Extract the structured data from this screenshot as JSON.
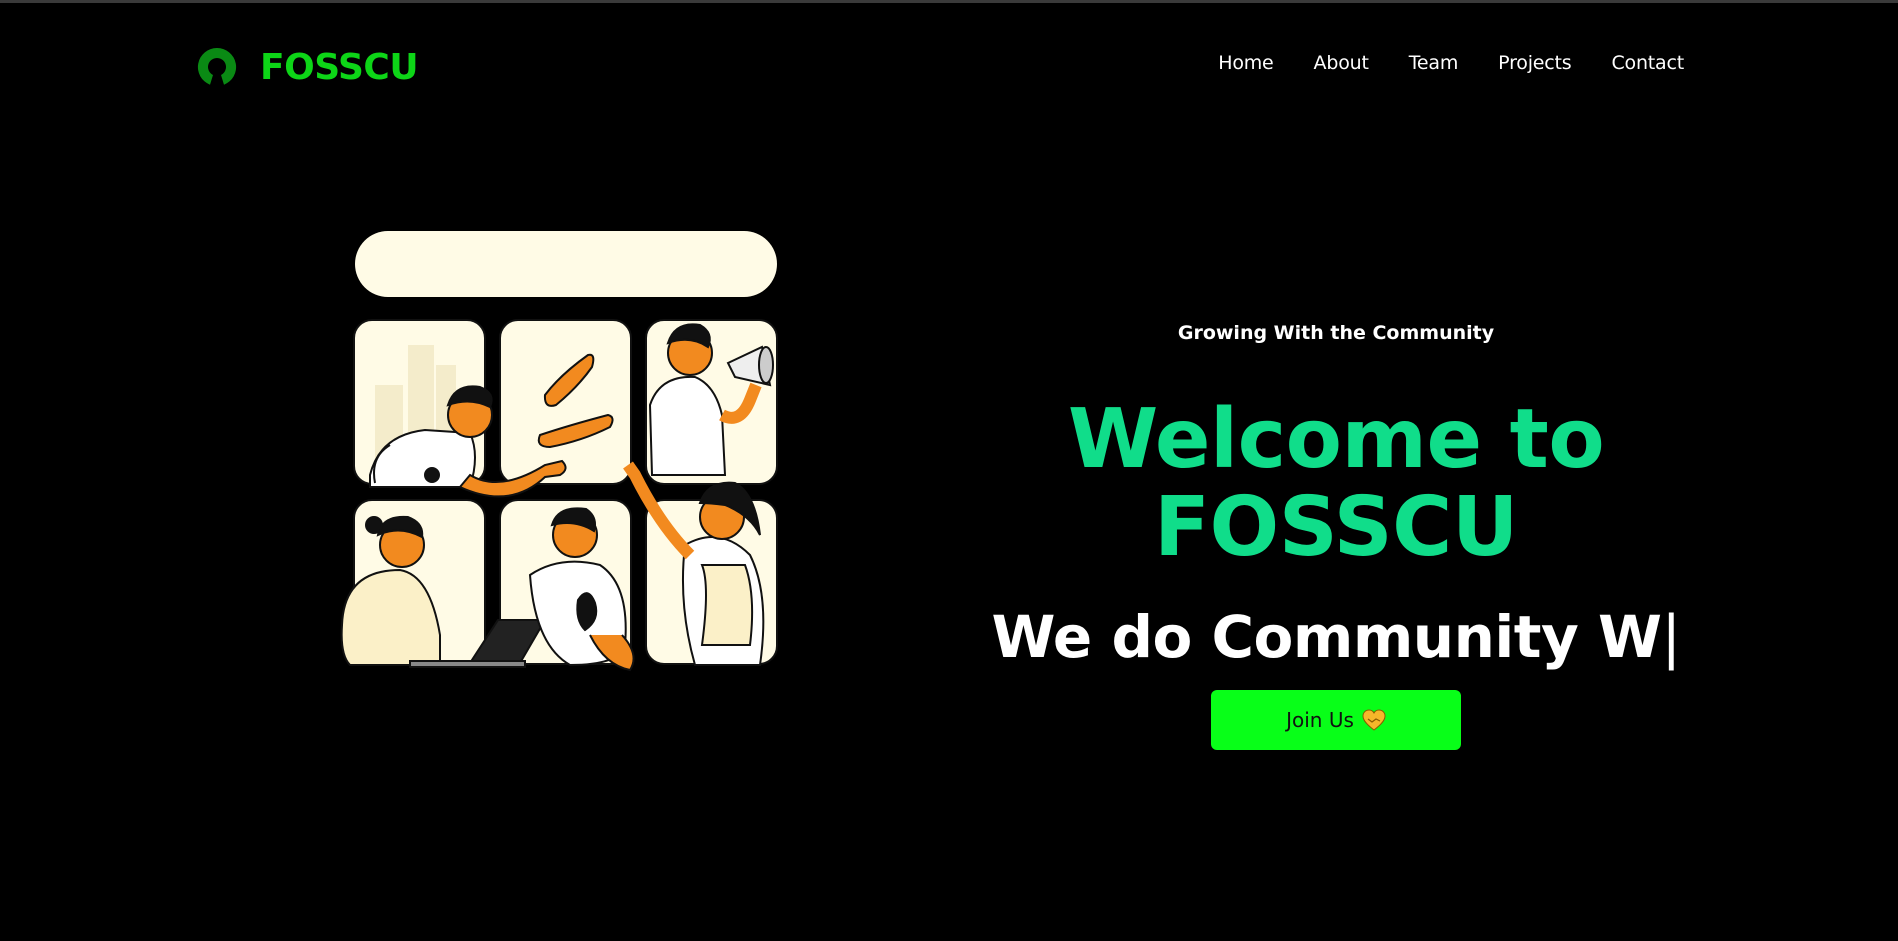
{
  "header": {
    "brand": "FOSSCU",
    "nav": [
      "Home",
      "About",
      "Team",
      "Projects",
      "Contact"
    ]
  },
  "hero": {
    "tagline": "Growing With the Community",
    "welcome": "Welcome to FOSSCU",
    "typed_text": "We do Community W",
    "cursor": "|",
    "join_label": "Join Us"
  },
  "colors": {
    "background": "#000000",
    "brand": "#0dd517",
    "welcome": "#10dd8a",
    "button": "#08ff18",
    "illustration_panel": "#fffbe6",
    "illustration_accent": "#f28a1f"
  },
  "icons": {
    "logo": "open-source-keyhole-icon",
    "button": "heart-handshake-icon"
  }
}
